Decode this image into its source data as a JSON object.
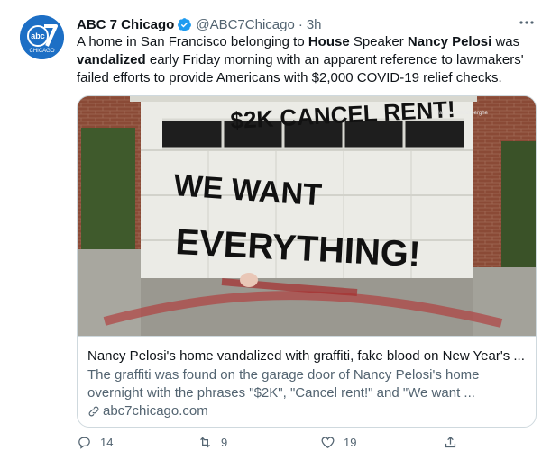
{
  "tweet": {
    "account_name": "ABC 7 Chicago",
    "handle": "@ABC7Chicago",
    "separator": "·",
    "time": "3h",
    "text_parts": [
      {
        "t": "A home in San Francisco belonging to ",
        "b": false
      },
      {
        "t": "House",
        "b": true
      },
      {
        "t": " Speaker ",
        "b": false
      },
      {
        "t": "Nancy Pelosi",
        "b": true
      },
      {
        "t": " was ",
        "b": false
      },
      {
        "t": "vandalized",
        "b": true
      },
      {
        "t": " early Friday morning with an apparent reference to lawmakers' failed efforts to provide Americans with $2,000 COVID-19 relief checks.",
        "b": false
      }
    ]
  },
  "avatar": {
    "brand_top": "abc",
    "brand_number": "7",
    "brand_bottom": "CHICAGO",
    "color": "#1d6fc5"
  },
  "card": {
    "image_credit": "Maggie Vanderberghe",
    "graffiti": [
      "$2K CANCEL RENT!",
      "WE WANT",
      "EVERYTHING!"
    ],
    "title": "Nancy Pelosi's home vandalized with graffiti, fake blood on New Year's ...",
    "description": "The graffiti was found on the garage door of Nancy Pelosi's home overnight with the phrases \"$2K\", \"Cancel rent!\" and \"We want ...",
    "domain": "abc7chicago.com"
  },
  "actions": {
    "replies": "14",
    "retweets": "9",
    "likes": "19"
  },
  "icons": {
    "verified": "verified-badge-icon",
    "more": "more-icon",
    "link": "link-icon",
    "reply": "reply-icon",
    "retweet": "retweet-icon",
    "like": "like-icon",
    "share": "share-icon"
  },
  "colors": {
    "verified": "#1d9bf0",
    "muted": "#536471",
    "text": "#0f1419",
    "border": "#cfd9de"
  }
}
